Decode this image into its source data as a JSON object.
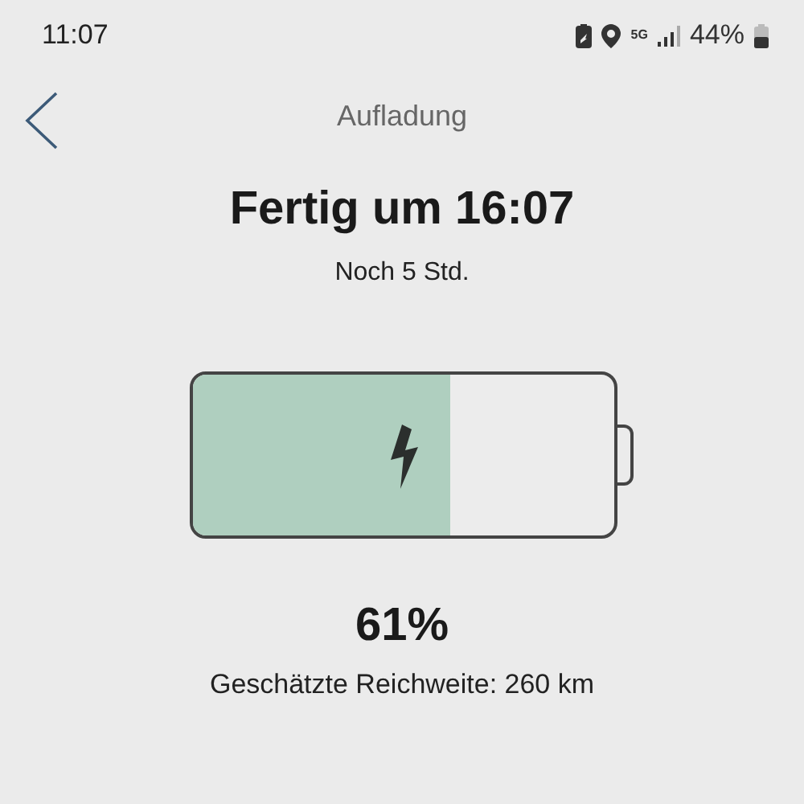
{
  "status_bar": {
    "time": "11:07",
    "network": "5G",
    "battery": "44%"
  },
  "header": {
    "title": "Aufladung"
  },
  "charge": {
    "title": "Fertig um 16:07",
    "remaining": "Noch 5 Std.",
    "level": 0.61,
    "charging": true,
    "percent": "61%",
    "range": "Geschätzte Reichweite: 260 km"
  }
}
